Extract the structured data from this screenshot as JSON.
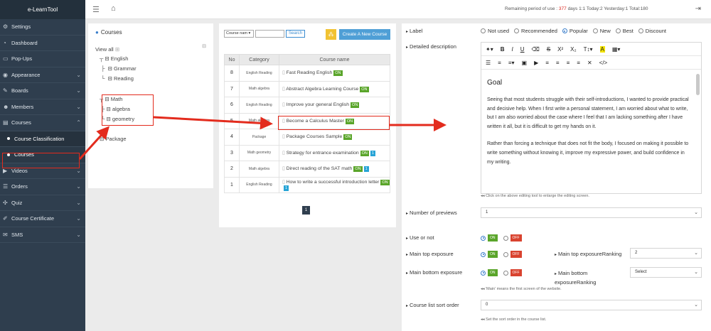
{
  "app": {
    "title": "e-LearnTool"
  },
  "topbar": {
    "status_prefix": "Remaining period of use :",
    "days": "377",
    "status_rest": "days  1:1 Today:2 Yesterday:1 Total:180"
  },
  "sidebar": {
    "items": [
      {
        "label": "Settings",
        "icon": "gear-icon"
      },
      {
        "label": "Dashboard",
        "icon": "dashboard-icon"
      },
      {
        "label": "Pop-Ups",
        "icon": "popup-icon"
      },
      {
        "label": "Appearance",
        "icon": "appearance-icon"
      },
      {
        "label": "Boards",
        "icon": "pencil-icon"
      },
      {
        "label": "Members",
        "icon": "users-icon"
      },
      {
        "label": "Courses",
        "icon": "folder-icon"
      },
      {
        "label": "Course Classification"
      },
      {
        "label": "Courses"
      },
      {
        "label": "Videos",
        "icon": "video-icon"
      },
      {
        "label": "Orders",
        "icon": "cart-icon"
      },
      {
        "label": "Quiz",
        "icon": "puzzle-icon"
      },
      {
        "label": "Course Certificate",
        "icon": "certificate-icon"
      },
      {
        "label": "SMS",
        "icon": "sms-icon"
      }
    ]
  },
  "tree": {
    "title": "Courses",
    "view_all": "View all",
    "nodes": [
      "English",
      "Grammar",
      "Reading",
      "Math",
      "algebra",
      "geometry",
      "Package"
    ]
  },
  "list": {
    "filter_select": "Course nam",
    "search_placeholder": "",
    "search_btn": "Search",
    "create_btn": "Create A New Course",
    "columns": [
      "No",
      "Category",
      "Course name"
    ],
    "rows": [
      {
        "no": "8",
        "cat": "English Reading",
        "name": "Fast Reading English",
        "tags": [
          "ON"
        ]
      },
      {
        "no": "7",
        "cat": "Math algebra",
        "name": "Abstract Algebra Learning Course",
        "tags": [
          "ON"
        ]
      },
      {
        "no": "6",
        "cat": "English Reading",
        "name": "Improve your general English",
        "tags": [
          "ON"
        ]
      },
      {
        "no": "5",
        "cat": "Math algebra",
        "name": "Become a Calculus Master",
        "tags": [
          "ON"
        ]
      },
      {
        "no": "4",
        "cat": "Package",
        "name": "Package Courses Sample",
        "tags": [
          "ON"
        ]
      },
      {
        "no": "3",
        "cat": "Math geometry",
        "name": "Strategy for entrance examination",
        "tags": [
          "ON",
          "1"
        ]
      },
      {
        "no": "2",
        "cat": "Math algebra",
        "name": "Direct reading of the SAT math",
        "tags": [
          "ON",
          "1"
        ]
      },
      {
        "no": "1",
        "cat": "English Reading",
        "name": "How to write a successful introduction letter",
        "tags": [
          "ON",
          "1"
        ]
      }
    ],
    "page": "1"
  },
  "form": {
    "label": "Label",
    "label_options": [
      "Not used",
      "Recommended",
      "Popular",
      "New",
      "Best",
      "Discount"
    ],
    "label_selected": "Popular",
    "desc_label": "Detailed description",
    "editor": {
      "heading": "Goal",
      "p1": "Seeing that most students struggle with their self-introductions, I wanted to provide practical and decisive help. When I first write a personal statement, I am worried about what to write, but I am also worried about the case where I feel that I am lacking something after I have written it all, but it is difficult to get my hands on it.",
      "p2": "Rather than forcing a technique that does not fit the body, I focused on making it possible to write something without knowing it, improve my expressive power, and build confidence in my writing."
    },
    "editor_hint": "Click on the above editing tool to enlarge the editing screen.",
    "previews_label": "Number of previews",
    "previews_value": "1",
    "use_label": "Use or not",
    "main_top_label": "Main top exposure",
    "main_top_rank_label": "Main top exposureRanking",
    "main_top_rank_value": "2",
    "main_bottom_label": "Main bottom exposure",
    "main_bottom_rank_label": "Main bottom exposureRanking",
    "main_bottom_rank_value": "Select",
    "main_hint": "'Main' means the first screen of the website.",
    "sort_label": "Course list sort order",
    "sort_value": "0",
    "sort_hint": "Set the sort order in the course list.",
    "on": "ON",
    "off": "OFF"
  },
  "colors": {
    "highlight": "#e32b1d",
    "sidebar": "#2f3e4e",
    "on": "#5aa52a",
    "off": "#d9432f"
  }
}
